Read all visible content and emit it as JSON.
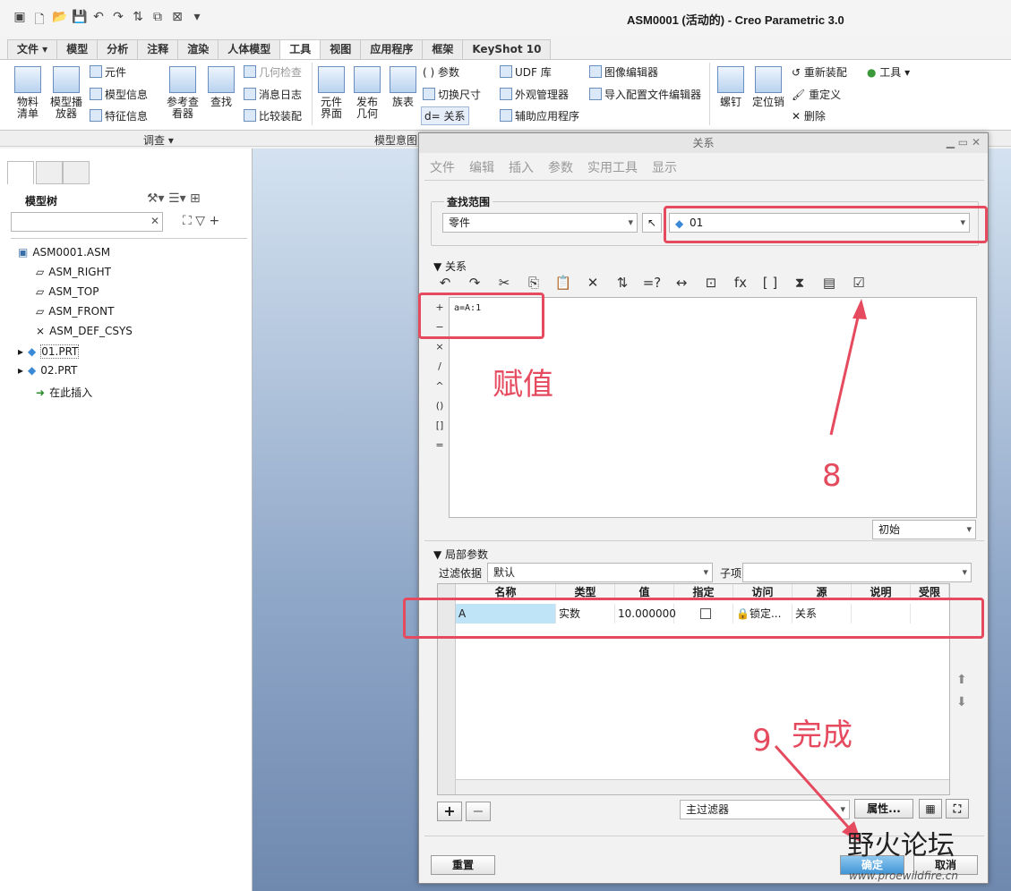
{
  "window": {
    "title": "ASM0001 (活动的) - Creo Parametric 3.0"
  },
  "ribbon_tabs": [
    "文件 ▾",
    "模型",
    "分析",
    "注释",
    "渲染",
    "人体模型",
    "工具",
    "视图",
    "应用程序",
    "框架",
    "KeyShot 10"
  ],
  "ribbon": {
    "bom": "物料\n清单",
    "model_player": "模型播\n放器",
    "component": "元件",
    "model_info": "模型信息",
    "feature_info": "特征信息",
    "ref_viewer": "参考查\n看器",
    "find": "查找",
    "geom_check": "几何检查",
    "msg_log": "消息日志",
    "compare_asm": "比较装配",
    "comp_interface": "元件\n界面",
    "publish_geom": "发布\n几何",
    "family_table": "族表",
    "params": "参数",
    "switch_dims": "切换尺寸",
    "relations": "关系",
    "udf_lib": "UDF 库",
    "appearance_mgr": "外观管理器",
    "aux_app": "辅助应用程序",
    "image_editor": "图像编辑器",
    "import_config": "导入配置文件编辑器",
    "screw": "螺钉",
    "pin": "定位销",
    "reassemble": "重新装配",
    "redefine": "重定义",
    "delete": "删除",
    "tools": "工具 ▾",
    "group_investigate": "调查 ▾",
    "group_model_intent": "模型意图"
  },
  "model_tree": {
    "title": "模型树",
    "items": [
      "ASM0001.ASM",
      "ASM_RIGHT",
      "ASM_TOP",
      "ASM_FRONT",
      "ASM_DEF_CSYS",
      "01.PRT",
      "02.PRT",
      "在此插入"
    ]
  },
  "dialog": {
    "title": "关系",
    "menu": [
      "文件",
      "编辑",
      "插入",
      "参数",
      "实用工具",
      "显示"
    ],
    "scope_label": "查找范围",
    "scope_type": "零件",
    "scope_object": "01",
    "relations_label": "关系",
    "relation_text": "a=A:1",
    "operators": [
      "+",
      "−",
      "×",
      "/",
      "^",
      "()",
      "[]",
      "="
    ],
    "initial": "初始",
    "local_params_label": "局部参数",
    "filter_label": "过滤依据",
    "filter_value": "默认",
    "subitem_label": "子项",
    "columns": [
      "名称",
      "类型",
      "值",
      "指定",
      "访问",
      "源",
      "说明",
      "受限"
    ],
    "row": {
      "name": "A",
      "type": "实数",
      "value": "10.000000",
      "access": "锁定...",
      "source": "关系"
    },
    "main_filter": "主过滤器",
    "properties": "属性...",
    "reset": "重置",
    "ok": "确定",
    "cancel": "取消"
  },
  "annotations": {
    "assign": "赋值",
    "step8": "8",
    "step9": "9",
    "done": "完成"
  },
  "watermark": {
    "text": "野火论坛",
    "url": "www.proewildfire.cn"
  },
  "colors": {
    "highlight": "#e54a5e",
    "accent": "#1a73b5"
  }
}
